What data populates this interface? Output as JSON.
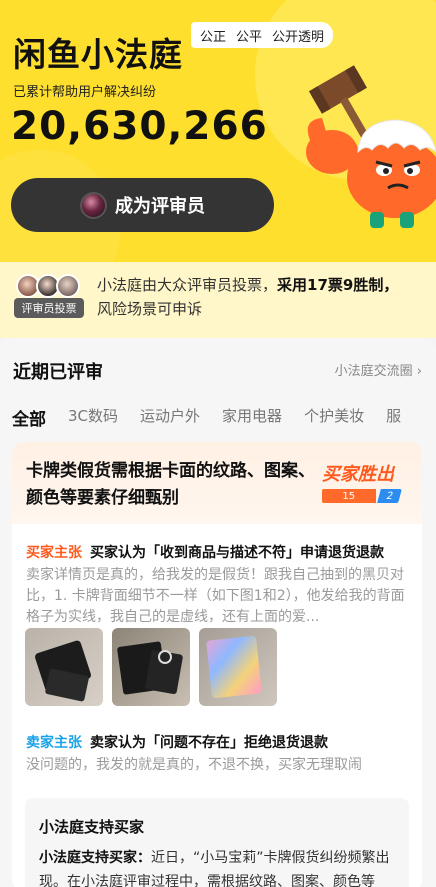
{
  "hero": {
    "title": "闲鱼小法庭",
    "tags": [
      "公正",
      "公平",
      "公开透明"
    ],
    "subtitle": "已累计帮助用户解决纠纷",
    "count": "20,630,266",
    "cta_label": "成为评审员"
  },
  "info": {
    "badge": "评审员投票",
    "text_a": "小法庭由大众评审员投票，",
    "text_b": "采用17票9胜制，",
    "text_c": "风险场景可申诉"
  },
  "section": {
    "title": "近期已评审",
    "link": "小法庭交流圈",
    "categories": [
      "全部",
      "3C数码",
      "运动户外",
      "家用电器",
      "个护美妆",
      "服"
    ]
  },
  "case": {
    "question": "卡牌类假货需根据卡面的纹路、图案、颜色等要素仔细甄别",
    "verdict": "买家胜出",
    "votes_buyer": "15",
    "votes_seller": "2",
    "buyer_tag": "买家主张",
    "buyer_claim": "买家认为「收到商品与描述不符」申请退货退款",
    "buyer_desc": "卖家详情页是真的，给我发的是假货！跟我自己抽到的黑贝对比，1. 卡牌背面细节不一样（如下图1和2），他发给我的背面格子为实线，我自己的是虚线，还有上面的爱...",
    "seller_tag": "卖家主张",
    "seller_claim": "卖家认为「问题不存在」拒绝退货退款",
    "seller_desc": "没问题的，我发的就是真的，不退不换，买家无理取闹",
    "support_title": "小法庭支持买家",
    "support_lead": "小法庭支持买家：",
    "support_text": "近日，“小马宝莉”卡牌假货纠纷频繁出现。在小法庭评审过程中，需根据纹路、图案、颜色等"
  },
  "colors": {
    "hero_yellow": "#ffdf2e",
    "buyer_orange": "#ff5a1e",
    "seller_blue": "#1aa3e8"
  }
}
